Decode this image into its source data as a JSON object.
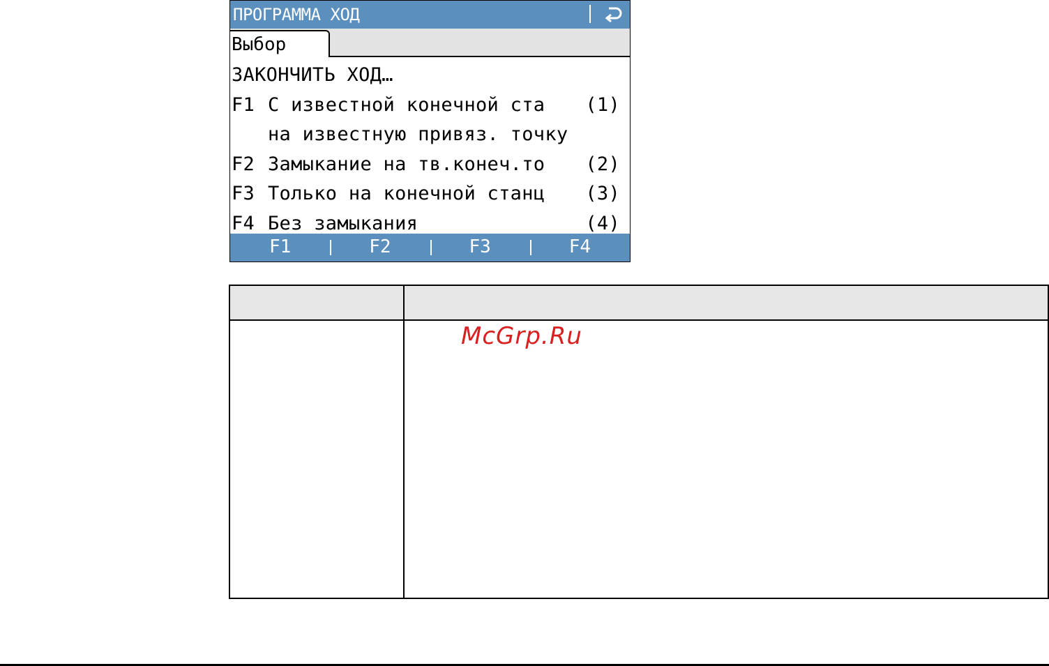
{
  "screen": {
    "title": "ПРОГРАММА ХОД",
    "back_icon": "return-arrow-icon",
    "tab": "Выбор",
    "heading": "ЗАКОНЧИТЬ ХОД…",
    "options": [
      {
        "key": "F1",
        "text": "С известной конечной ста",
        "num": "(1)"
      },
      {
        "key": "F2",
        "text": "Замыкание на тв.конеч.то",
        "num": "(2)"
      },
      {
        "key": "F3",
        "text": "Только на конечной станц",
        "num": "(3)"
      },
      {
        "key": "F4",
        "text": "Без замыкания",
        "num": "(4)"
      }
    ],
    "option1_continuation": "на известную привяз. точку",
    "softkeys": [
      "F1",
      "F2",
      "F3",
      "F4"
    ],
    "accent_color": "#5b8fbe"
  },
  "watermark": "McGrp.Ru"
}
